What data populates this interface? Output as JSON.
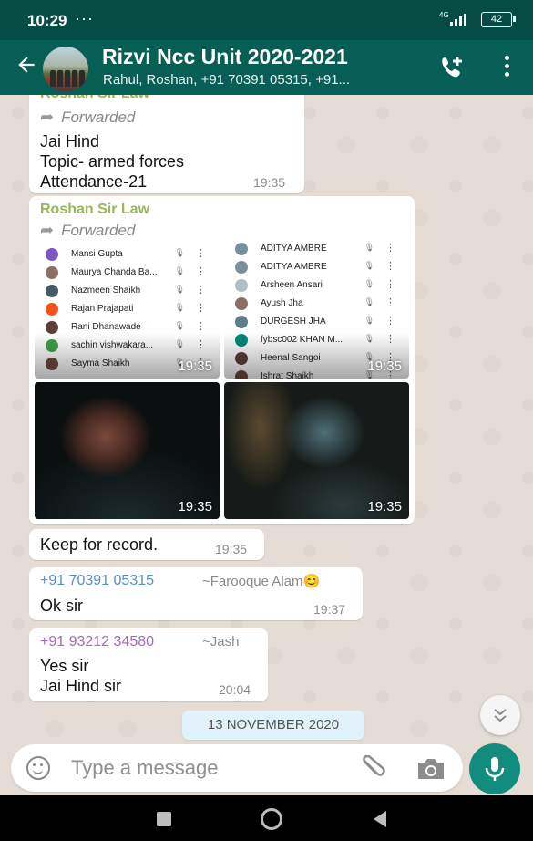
{
  "status_bar": {
    "time": "10:29",
    "dots": "···",
    "network": "4G",
    "battery": "42"
  },
  "header": {
    "group_name": "Rizvi Ncc Unit 2020-2021",
    "members": "Rahul, Roshan, +91 70391 05315, +91..."
  },
  "messages": {
    "m1": {
      "sender_partial": "Roshan Sir Law",
      "forwarded": "Forwarded",
      "lines": [
        "Jai Hind",
        "Topic- armed forces",
        "Attendance-21"
      ],
      "time": "19:35"
    },
    "m2": {
      "sender": "Roshan Sir Law",
      "forwarded": "Forwarded",
      "media": [
        {
          "time": "19:35",
          "contacts": [
            {
              "name": "Mansi Gupta",
              "color": "#7e57c2"
            },
            {
              "name": "Maurya Chanda Ba...",
              "color": "#8d6e63"
            },
            {
              "name": "Nazmeen Shaikh",
              "color": "#455a64"
            },
            {
              "name": "Rajan Prajapati",
              "color": "#f4511e"
            },
            {
              "name": "Rani Dhanawade",
              "color": "#5d4037"
            },
            {
              "name": "sachin vishwakara...",
              "color": "#43a047"
            },
            {
              "name": "Sayma Shaikh",
              "color": "#6d4c41"
            }
          ]
        },
        {
          "time": "19:35",
          "contacts": [
            {
              "name": "ADITYA AMBRE",
              "color": "#78909c"
            },
            {
              "name": "ADITYA AMBRE",
              "color": "#78909c"
            },
            {
              "name": "Arsheen Ansari",
              "color": "#b0bec5"
            },
            {
              "name": "Ayush Jha",
              "color": "#8d6e63"
            },
            {
              "name": "DURGESH JHA",
              "color": "#607d8b"
            },
            {
              "name": "fybsc002 KHAN M...",
              "color": "#00897b"
            },
            {
              "name": "Heenal Sangoi",
              "color": "#5d4037"
            },
            {
              "name": "Ishrat Shaikh",
              "color": "#6d4c41"
            }
          ]
        },
        {
          "time": "19:35"
        },
        {
          "time": "19:35"
        }
      ]
    },
    "m3": {
      "text": "Keep for record.",
      "time": "19:35"
    },
    "m4": {
      "phone": "+91 70391 05315",
      "alias": "~Farooque Alam😊",
      "text": "Ok sir",
      "time": "19:37",
      "phone_color": "#5b8fc9"
    },
    "m5": {
      "phone": "+91 93212 34580",
      "alias": "~Jash",
      "lines": [
        "Yes sir",
        "Jai Hind sir"
      ],
      "time": "20:04",
      "phone_color": "#a46bbf"
    }
  },
  "date_chip": "13 NOVEMBER 2020",
  "composer": {
    "placeholder": "Type a message"
  },
  "colors": {
    "header": "#075e54",
    "status_bar": "#054d44",
    "accent": "#128c7e",
    "chat_bg": "#e5ddd5"
  }
}
